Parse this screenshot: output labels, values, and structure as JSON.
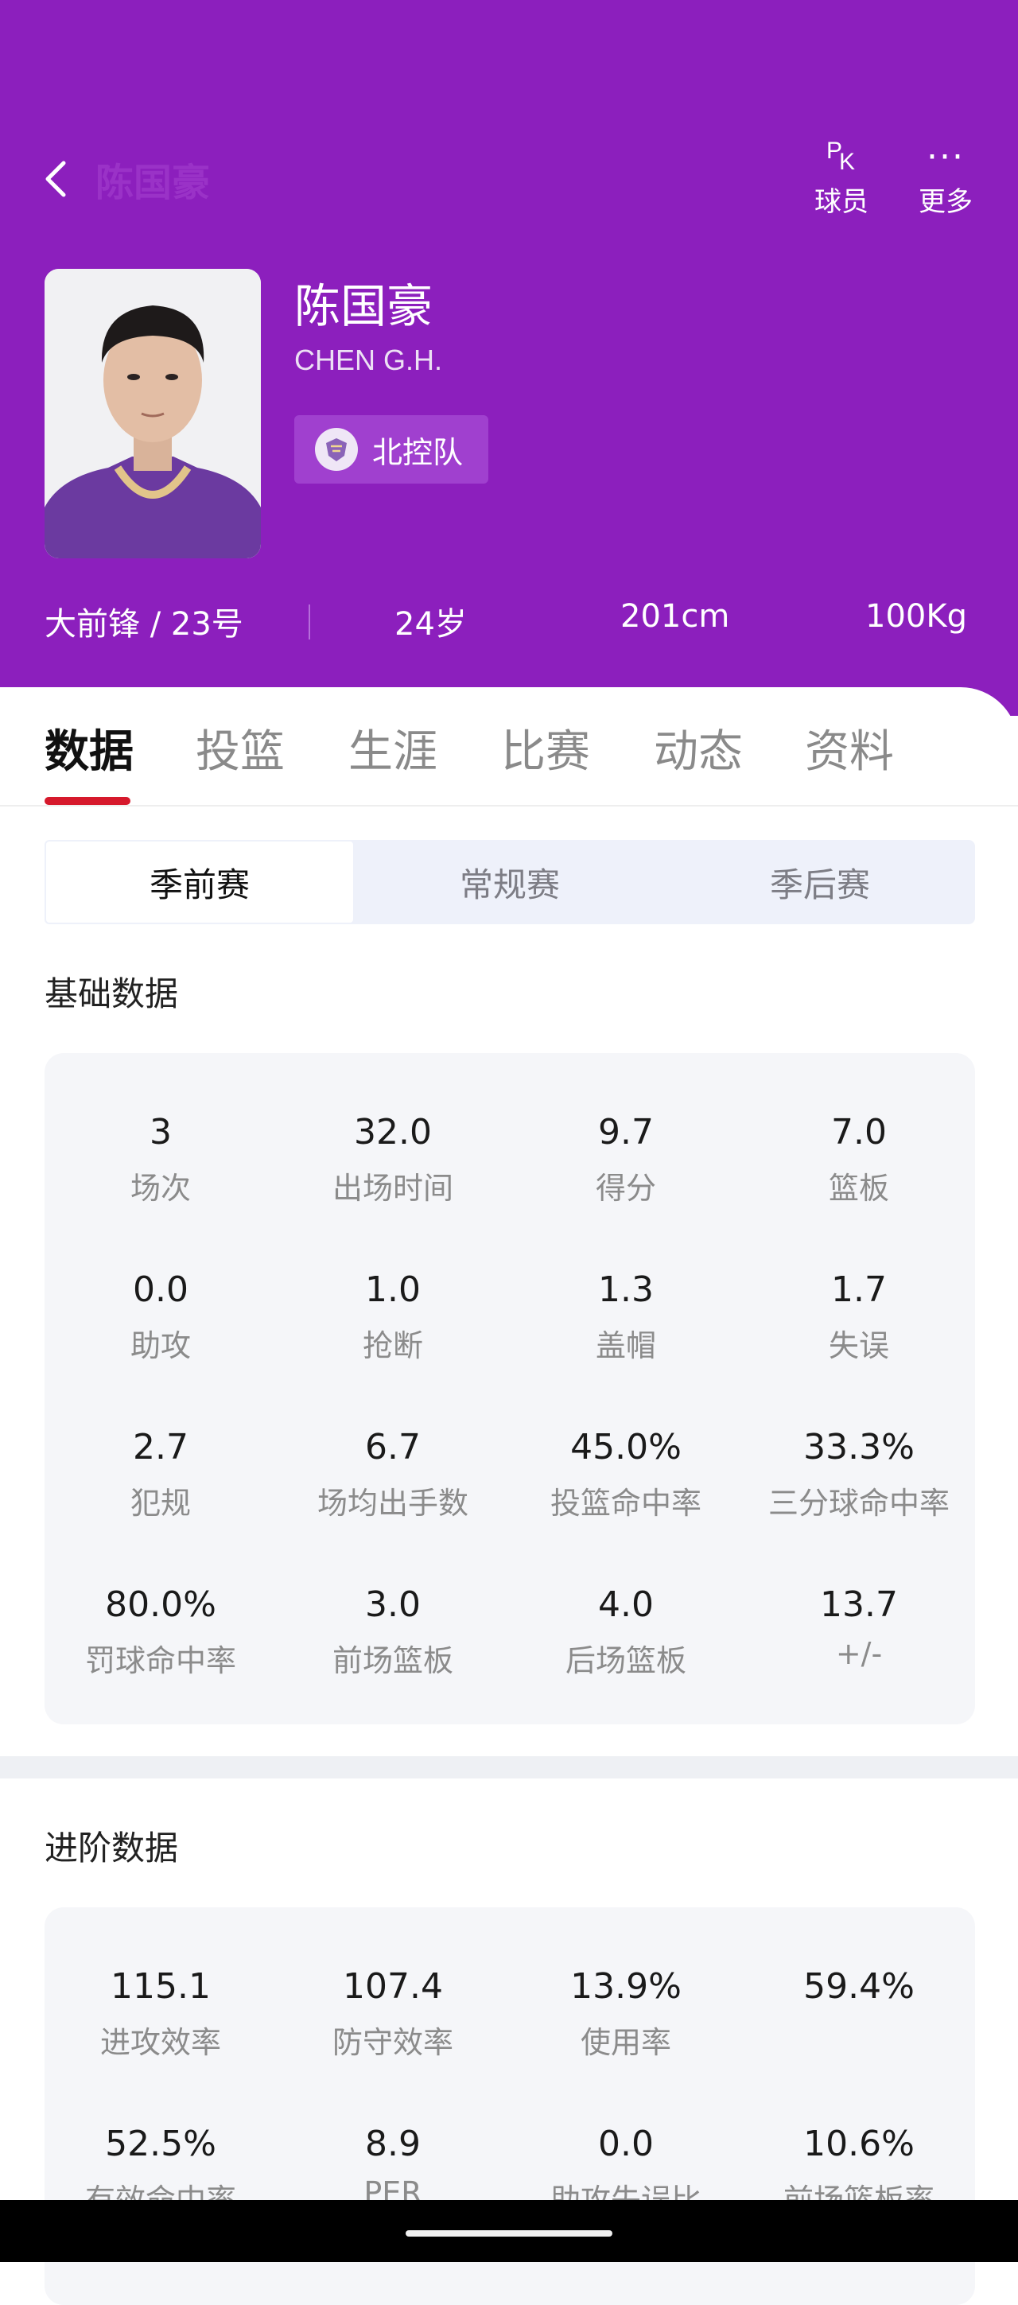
{
  "header": {
    "faded_title": "陈国豪",
    "pk_label": "球员",
    "more_label": "更多",
    "name": "陈国豪",
    "name_en": "CHEN G.H.",
    "team": "北控队",
    "position_number": "大前锋 / 23号",
    "age": "24岁",
    "height": "201cm",
    "weight": "100Kg",
    "bg_color": "#8c1fbd"
  },
  "tabs": [
    "数据",
    "投篮",
    "生涯",
    "比赛",
    "动态",
    "资料"
  ],
  "season_tabs": [
    "季前赛",
    "常规赛",
    "季后赛"
  ],
  "basic": {
    "title": "基础数据",
    "stats": [
      {
        "value": "3",
        "label": "场次"
      },
      {
        "value": "32.0",
        "label": "出场时间"
      },
      {
        "value": "9.7",
        "label": "得分"
      },
      {
        "value": "7.0",
        "label": "篮板"
      },
      {
        "value": "0.0",
        "label": "助攻"
      },
      {
        "value": "1.0",
        "label": "抢断"
      },
      {
        "value": "1.3",
        "label": "盖帽"
      },
      {
        "value": "1.7",
        "label": "失误"
      },
      {
        "value": "2.7",
        "label": "犯规"
      },
      {
        "value": "6.7",
        "label": "场均出手数"
      },
      {
        "value": "45.0%",
        "label": "投篮命中率"
      },
      {
        "value": "33.3%",
        "label": "三分球命中率"
      },
      {
        "value": "80.0%",
        "label": "罚球命中率"
      },
      {
        "value": "3.0",
        "label": "前场篮板"
      },
      {
        "value": "4.0",
        "label": "后场篮板"
      },
      {
        "value": "13.7",
        "label": "+/-"
      }
    ]
  },
  "advanced": {
    "title": "进阶数据",
    "stats": [
      {
        "value": "115.1",
        "label": "进攻效率"
      },
      {
        "value": "107.4",
        "label": "防守效率"
      },
      {
        "value": "13.9%",
        "label": "使用率"
      },
      {
        "value": "59.4%",
        "label": ""
      },
      {
        "value": "52.5%",
        "label": "有效命中率"
      },
      {
        "value": "8.9",
        "label": "PER"
      },
      {
        "value": "0.0",
        "label": "助攻失误比"
      },
      {
        "value": "10.6%",
        "label": "前场篮板率"
      }
    ]
  }
}
